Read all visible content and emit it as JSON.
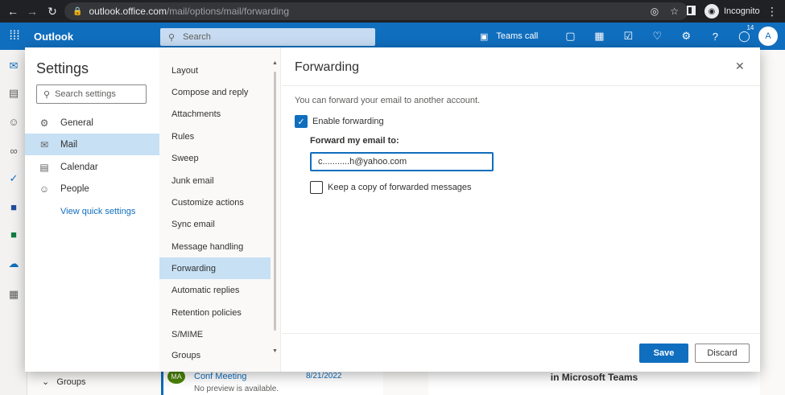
{
  "browser": {
    "url_host": "outlook.office.com",
    "url_path": "/mail/options/mail/forwarding",
    "profile_label": "Incognito"
  },
  "topbar": {
    "brand": "Outlook",
    "search_placeholder": "Search",
    "teams_call": "Teams call",
    "notification_count": "14",
    "avatar_initial": "A"
  },
  "settings": {
    "title": "Settings",
    "search_placeholder": "Search settings",
    "categories": [
      {
        "label": "General",
        "icon": "gear-icon"
      },
      {
        "label": "Mail",
        "icon": "mail-icon"
      },
      {
        "label": "Calendar",
        "icon": "calendar-icon"
      },
      {
        "label": "People",
        "icon": "people-icon"
      }
    ],
    "quick_settings": "View quick settings",
    "subcategories": [
      "Layout",
      "Compose and reply",
      "Attachments",
      "Rules",
      "Sweep",
      "Junk email",
      "Customize actions",
      "Sync email",
      "Message handling",
      "Forwarding",
      "Automatic replies",
      "Retention policies",
      "S/MIME",
      "Groups"
    ],
    "selected_category": "Mail",
    "selected_subcategory": "Forwarding"
  },
  "forwarding": {
    "title": "Forwarding",
    "description": "You can forward your email to another account.",
    "enable_label": "Enable forwarding",
    "enable_checked": true,
    "forward_to_label": "Forward my email to:",
    "forward_to_value": "c...........h@yahoo.com",
    "keep_copy_label": "Keep a copy of forwarded messages",
    "keep_copy_checked": false,
    "save_label": "Save",
    "discard_label": "Discard"
  },
  "background": {
    "groups_label": "Groups",
    "message_sender_initials": "MA",
    "message_subject": "Conf Meeting",
    "message_date": "8/21/2022",
    "message_preview": "No preview is available.",
    "teams_heading": "in Microsoft Teams"
  },
  "colors": {
    "accent": "#106ebe",
    "selected_bg": "#c7e0f4"
  }
}
